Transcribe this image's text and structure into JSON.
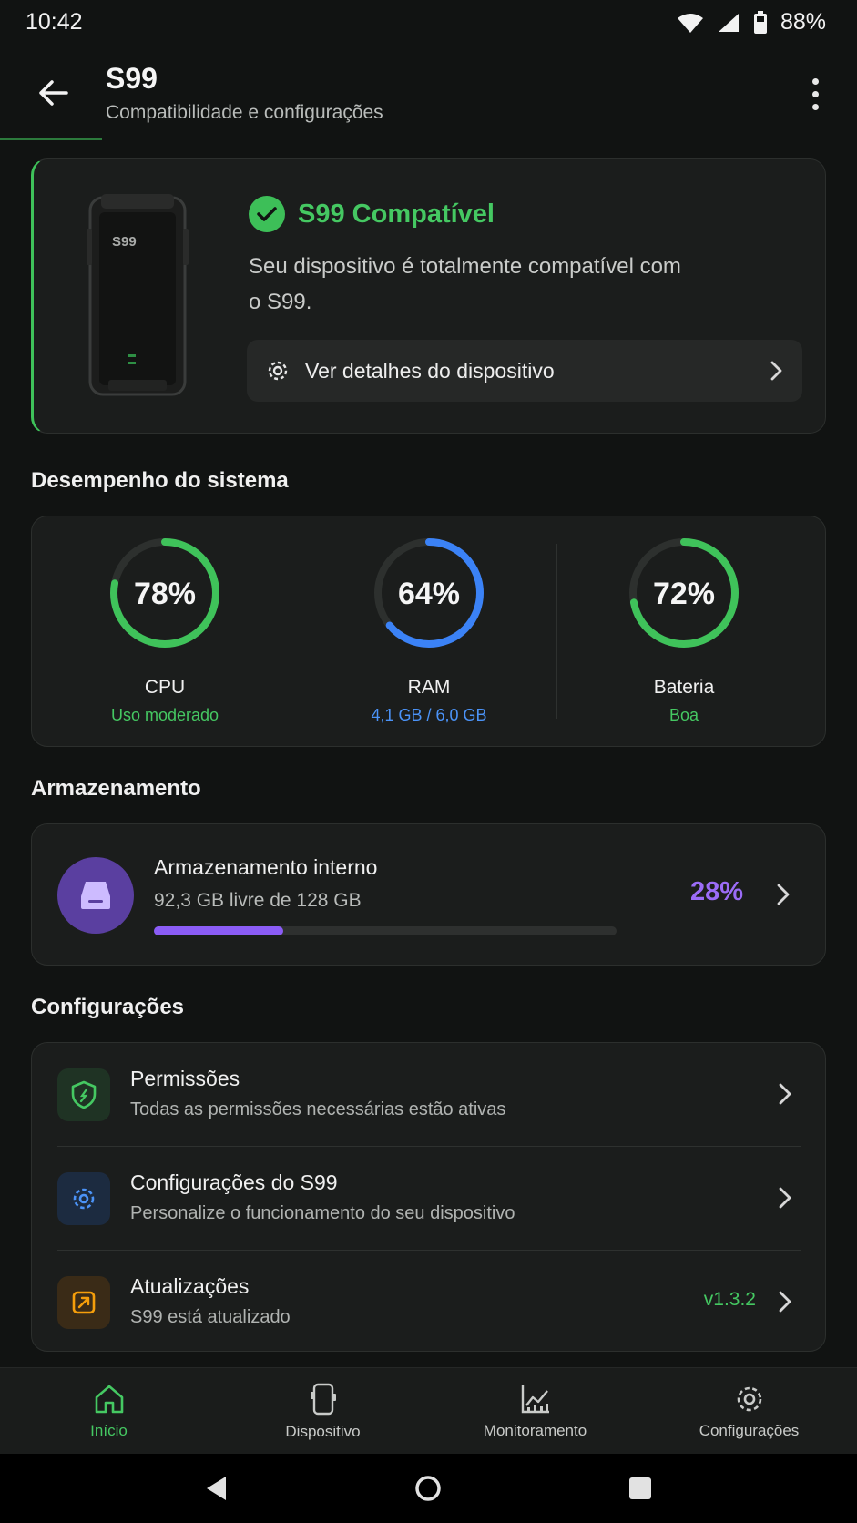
{
  "status_bar": {
    "time": "10:42",
    "battery_percent": "88%"
  },
  "header": {
    "title": "S99",
    "subtitle": "Compatibilidade e configurações"
  },
  "compat": {
    "device_label": "S99",
    "title": "S99 Compatível",
    "description": "Seu dispositivo é totalmente compatível com o S99.",
    "details_button": "Ver detalhes do dispositivo",
    "accent": "#45c862"
  },
  "performance": {
    "section_title": "Desempenho do sistema",
    "gauges": [
      {
        "value": "78%",
        "fraction": 0.78,
        "label": "CPU",
        "sub": "Uso moderado",
        "color": "#3fc25a",
        "sub_color": "#45c862"
      },
      {
        "value": "64%",
        "fraction": 0.64,
        "label": "RAM",
        "sub": "4,1 GB / 6,0 GB",
        "color": "#3b82f6",
        "sub_color": "#4b93f7"
      },
      {
        "value": "72%",
        "fraction": 0.72,
        "label": "Bateria",
        "sub": "Boa",
        "color": "#3fc25a",
        "sub_color": "#45c862"
      }
    ]
  },
  "storage": {
    "section_title": "Armazenamento",
    "name": "Armazenamento interno",
    "sub": "92,3 GB livre de 128 GB",
    "percent": "28%",
    "fraction": 0.28,
    "color": "#8b5cf6"
  },
  "settings": {
    "section_title": "Configurações",
    "items": [
      {
        "title": "Permissões",
        "sub": "Todas as permissões necessárias estão ativas",
        "icon": "shield-icon",
        "color": "#45c862"
      },
      {
        "title": "Configurações do S99",
        "sub": "Personalize o funcionamento do seu dispositivo",
        "icon": "gear-icon",
        "color": "#3b82f6"
      },
      {
        "title": "Atualizações",
        "sub": "S99 está atualizado",
        "version": "v1.3.2",
        "icon": "update-icon",
        "color": "#f59e0b"
      }
    ]
  },
  "bottom_nav": {
    "items": [
      {
        "label": "Início",
        "icon": "home-icon",
        "active": true
      },
      {
        "label": "Dispositivo",
        "icon": "phone-icon",
        "active": false
      },
      {
        "label": "Monitoramento",
        "icon": "chart-icon",
        "active": false
      },
      {
        "label": "Configurações",
        "icon": "gear-icon",
        "active": false
      }
    ]
  }
}
